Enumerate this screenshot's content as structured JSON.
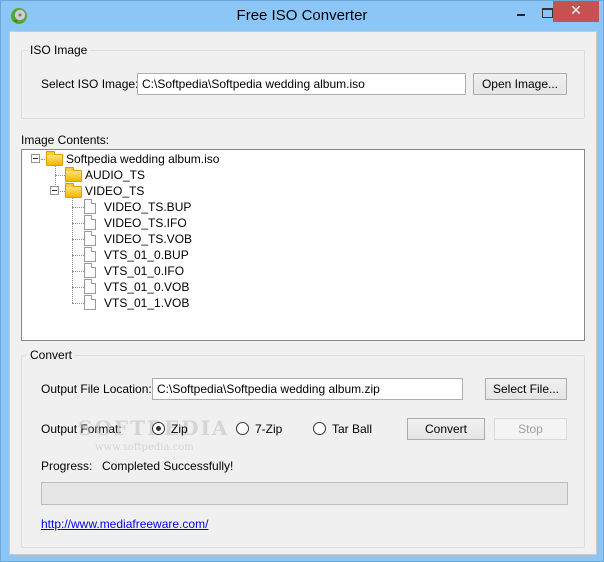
{
  "window": {
    "title": "Free ISO Converter",
    "close_glyph": "✕"
  },
  "iso_image": {
    "group_label": "ISO Image",
    "select_label": "Select ISO Image:",
    "path_value": "C:\\Softpedia\\Softpedia wedding album.iso",
    "open_button": "Open Image..."
  },
  "image_contents": {
    "label": "Image Contents:",
    "tree": {
      "root": "Softpedia wedding album.iso",
      "folders": [
        {
          "name": "AUDIO_TS",
          "files": []
        },
        {
          "name": "VIDEO_TS",
          "files": [
            "VIDEO_TS.BUP",
            "VIDEO_TS.IFO",
            "VIDEO_TS.VOB",
            "VTS_01_0.BUP",
            "VTS_01_0.IFO",
            "VTS_01_0.VOB",
            "VTS_01_1.VOB"
          ]
        }
      ]
    }
  },
  "convert": {
    "group_label": "Convert",
    "output_location_label": "Output File Location:",
    "output_location_value": "C:\\Softpedia\\Softpedia wedding album.zip",
    "select_file_button": "Select File...",
    "output_format_label": "Output Format:",
    "formats": [
      {
        "label": "Zip",
        "selected": true
      },
      {
        "label": "7-Zip",
        "selected": false
      },
      {
        "label": "Tar Ball",
        "selected": false
      }
    ],
    "convert_button": "Convert",
    "stop_button": "Stop",
    "progress_label": "Progress:",
    "progress_status": "Completed Successfully!",
    "progress_value": 0,
    "website_link": "http://www.mediafreeware.com/"
  },
  "watermark": {
    "brand": "SOFTPEDIA",
    "url": "www.softpedia.com"
  }
}
